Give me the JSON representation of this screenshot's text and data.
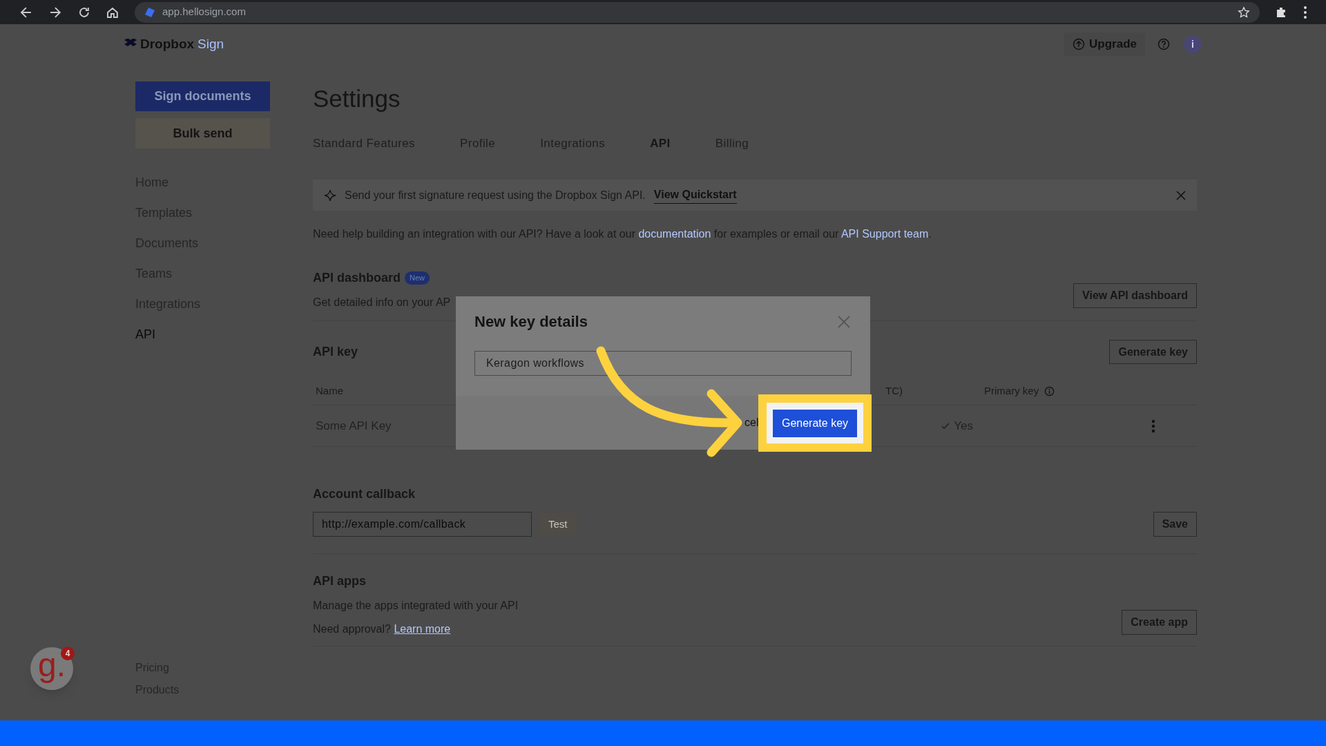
{
  "browser": {
    "url": "app.hellosign.com"
  },
  "header": {
    "brand": "Dropbox",
    "brand_suffix": "Sign",
    "upgrade": "Upgrade",
    "avatar": "i"
  },
  "sidebar": {
    "primary_button": "Sign documents",
    "secondary_button": "Bulk send",
    "items": [
      {
        "label": "Home",
        "selected": false
      },
      {
        "label": "Templates",
        "selected": false
      },
      {
        "label": "Documents",
        "selected": false
      },
      {
        "label": "Teams",
        "selected": false
      },
      {
        "label": "Integrations",
        "selected": false
      },
      {
        "label": "API",
        "selected": true
      }
    ],
    "footer_links": [
      "Pricing",
      "Products"
    ]
  },
  "page": {
    "title": "Settings",
    "tabs": [
      {
        "label": "Standard Features",
        "selected": false
      },
      {
        "label": "Profile",
        "selected": false
      },
      {
        "label": "Integrations",
        "selected": false
      },
      {
        "label": "API",
        "selected": true
      },
      {
        "label": "Billing",
        "selected": false
      }
    ],
    "banner": {
      "text": "Send your first signature request using the Dropbox Sign API.",
      "link": "View Quickstart"
    },
    "help_parts": [
      "Need help building an integration with our API? Have a look at our ",
      "documentation",
      " for examples or email our ",
      "API Support team",
      "."
    ],
    "dashboard": {
      "title": "API dashboard",
      "badge": "New",
      "description": "Get detailed info on your AP",
      "button": "View API dashboard"
    },
    "api_key": {
      "title": "API key",
      "button": "Generate key",
      "columns": [
        "Name",
        "TC)",
        "Primary key"
      ],
      "rows": [
        {
          "name": "Some API Key",
          "primary": "Yes"
        }
      ]
    },
    "callback": {
      "title": "Account callback",
      "placeholder": "http://example.com/callback",
      "test": "Test",
      "save": "Save"
    },
    "apps": {
      "title": "API apps",
      "description": "Manage the apps integrated with your API",
      "approval": "Need approval?",
      "link": "Learn more",
      "button": "Create app"
    }
  },
  "modal": {
    "title": "New key details",
    "value": "Keragon workflows",
    "cancel": "cel",
    "confirm": "Generate key"
  },
  "widget": {
    "logo": "g.",
    "badge": "4"
  }
}
